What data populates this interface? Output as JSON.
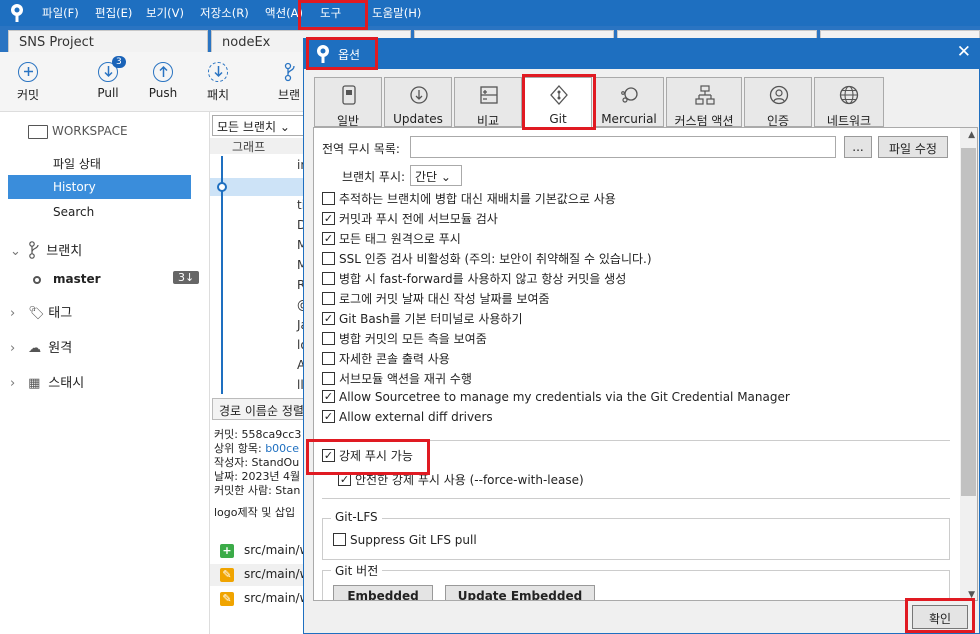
{
  "menubar": {
    "items": [
      "파일(F)",
      "편집(E)",
      "보기(V)",
      "저장소(R)",
      "액션(A)",
      "도구",
      "도움말(H)"
    ]
  },
  "doc_tabs": [
    "SNS Project",
    "nodeEx"
  ],
  "toolbar": {
    "commit_label": "커밋",
    "pull_label": "Pull",
    "pull_badge": "3",
    "push_label": "Push",
    "patch_label": "패치",
    "branch_label": "브랜"
  },
  "sidebar": {
    "workspace_title": "WORKSPACE",
    "workspace_items": [
      "파일 상태",
      "History",
      "Search"
    ],
    "branches_label": "브랜치",
    "master_label": "master",
    "master_badge": "3↓",
    "tags_label": "태그",
    "remotes_label": "원격",
    "stashes_label": "스태시"
  },
  "center": {
    "branch_combo": "모든 브랜치",
    "graph_header": "그래프",
    "graph_rows": [
      "in",
      "",
      "ti",
      "D",
      "M",
      "M",
      "R",
      "@",
      "Ja",
      "lo",
      "A",
      "ll"
    ],
    "sort_label": "경로 이름순 정렬",
    "detail": {
      "commit": "커밋: 558ca9cc3",
      "parent_label": "상위 항목: ",
      "parent_value": "b00ce",
      "author": "작성자: StandOu",
      "date": "날짜: 2023년 4월",
      "committer": "커밋한 사람: Stan",
      "message": "logo제작 및 삽입"
    },
    "files": [
      "src/main/w",
      "src/main/w",
      "src/main/w"
    ]
  },
  "dialog": {
    "title": "옵션",
    "close_glyph": "✕",
    "tabs": [
      "일반",
      "Updates",
      "비교",
      "Git",
      "Mercurial",
      "커스텀 액션",
      "인증",
      "네트워크"
    ],
    "global_ignore_label": "전역 무시 목록:",
    "browse_label": "...",
    "edit_file_label": "파일 수정",
    "branch_push_label": "브랜치 푸시:",
    "branch_push_value": "간단",
    "options": [
      {
        "label": "추적하는 브랜치에 병합 대신 재배치를 기본값으로 사용",
        "checked": false
      },
      {
        "label": "커밋과 푸시 전에 서브모듈 검사",
        "checked": true
      },
      {
        "label": "모든 태그 원격으로 푸시",
        "checked": true
      },
      {
        "label": "SSL 인증 검사 비활성화 (주의: 보안이 취약해질 수 있습니다.)",
        "checked": false
      },
      {
        "label": "병합 시 fast-forward를 사용하지 않고 항상 커밋을 생성",
        "checked": false
      },
      {
        "label": "로그에 커밋 날짜 대신 작성 날짜를 보여줌",
        "checked": false
      },
      {
        "label": "Git Bash를 기본 터미널로 사용하기",
        "checked": true
      },
      {
        "label": "병합 커밋의 모든 측을 보여줌",
        "checked": false
      },
      {
        "label": "자세한 콘솔 출력 사용",
        "checked": false
      },
      {
        "label": "서브모듈 액션을 재귀 수행",
        "checked": false
      },
      {
        "label": "Allow Sourcetree to manage my credentials via the Git Credential Manager",
        "checked": true
      },
      {
        "label": "Allow external diff drivers",
        "checked": true
      }
    ],
    "force_push_label": "강제 푸시 가능",
    "force_with_lease_label": "안전한 강제 푸시 사용 (--force-with-lease)",
    "git_lfs_title": "Git-LFS",
    "suppress_lfs_label": "Suppress Git LFS pull",
    "git_version_title": "Git 버전",
    "embedded_label": "Embedded",
    "update_embedded_label": "Update Embedded",
    "ok_label": "확인"
  },
  "colors": {
    "accent": "#1e6fc0",
    "highlight": "#e01a22",
    "selected": "#3a8ddb"
  }
}
